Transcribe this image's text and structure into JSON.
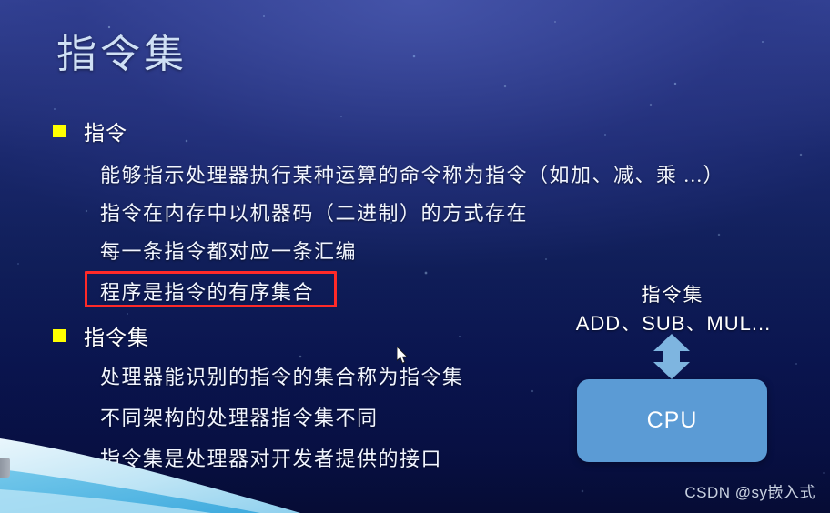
{
  "slide": {
    "title": "指令集",
    "sections": [
      {
        "bullet": "指令",
        "lines": [
          "能够指示处理器执行某种运算的命令称为指令（如加、减、乘 ...）",
          "指令在内存中以机器码（二进制）的方式存在",
          "每一条指令都对应一条汇编",
          "程序是指令的有序集合"
        ]
      },
      {
        "bullet": "指令集",
        "lines": [
          "处理器能识别的指令的集合称为指令集",
          "不同架构的处理器指令集不同",
          "指令集是处理器对开发者提供的接口"
        ]
      }
    ],
    "highlight": {
      "text": "程序是指令的有序集合",
      "border_color": "#ff2a28"
    },
    "diagram": {
      "title": "指令集",
      "operations": "ADD、SUB、MUL...",
      "arrow": "double-headed-vertical-arrow",
      "box_label": "CPU",
      "box_color": "#5b9bd5",
      "arrow_color": "#7eb5e0"
    },
    "watermark": "CSDN @sy嵌入式",
    "theme": {
      "bullet_color": "#ffff00",
      "title_color": "#cfe0f5",
      "text_color": "#f2f6ff",
      "background_top": "#3a4aa0",
      "background_bottom": "#050b33"
    }
  }
}
